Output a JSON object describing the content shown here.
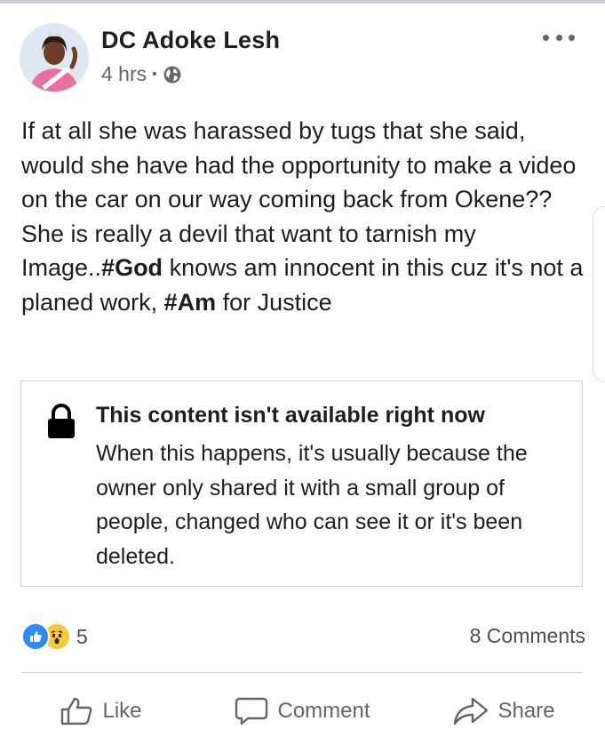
{
  "post": {
    "author": "DC Adoke Lesh",
    "time": "4 hrs",
    "separator": "•",
    "privacy_icon": "globe-icon",
    "text": {
      "p1": "If at all she was harassed by tugs that she said, would she have had the opportunity to make a video on the car on our way coming back from Okene??",
      "p2_a": "She is really a devil that want to tarnish my Image..",
      "p2_tag1": "#God",
      "p2_b": " knows am innocent in this cuz it's not a planed work, ",
      "p2_tag2": "#Am",
      "p2_c": " for Justice"
    }
  },
  "unavailable": {
    "icon": "lock-icon",
    "title": "This content isn't available right now",
    "body": "When this happens, it's usually because the owner only shared it with a small group of people, changed who can see it or it's been deleted."
  },
  "engagement": {
    "reaction_icons": [
      "like-reaction-icon",
      "wow-reaction-icon"
    ],
    "reaction_count": "5",
    "comments": "8 Comments"
  },
  "actions": {
    "like": "Like",
    "comment": "Comment",
    "share": "Share"
  },
  "colors": {
    "like_blue": "#2e89ff",
    "wow_yellow": "#f7c83c",
    "text_primary": "#1c1e21",
    "text_secondary": "#65676b"
  }
}
